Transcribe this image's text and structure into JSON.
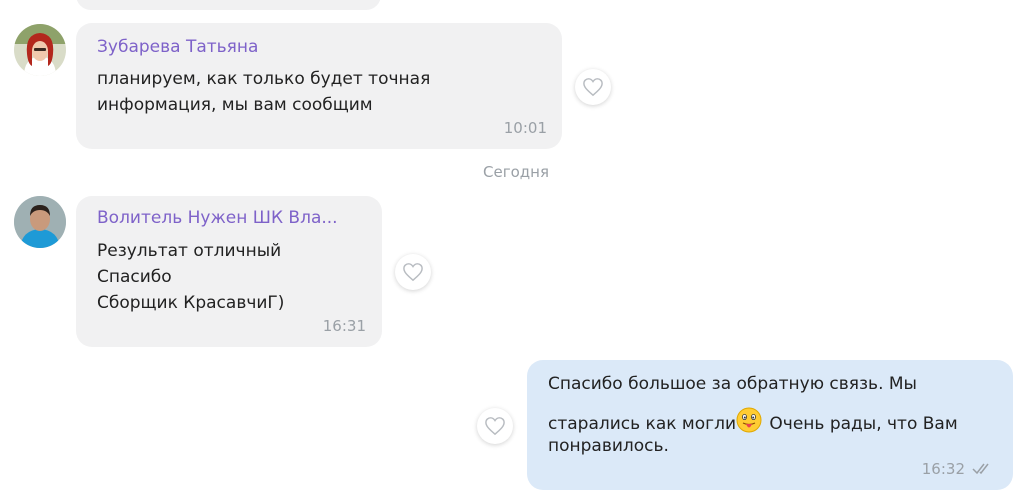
{
  "date_separator": "Сегодня",
  "messages": [
    {
      "sender": "Зубарева Татьяна",
      "lines": [
        "планируем, как только будет точная",
        "информация, мы вам сообщим"
      ],
      "time": "10:01",
      "avatar_icon": "avatar-woman-red-hair"
    },
    {
      "sender": "Волитель Нужен ШК Вла...",
      "lines": [
        "Результат отличный",
        "Спасибо",
        "Сборщик КрасавчиГ)"
      ],
      "time": "16:31",
      "avatar_icon": "avatar-man"
    },
    {
      "line1": "Спасибо большое за обратную связь.  Мы",
      "line2_before": "старались как могли",
      "line2_after": " Очень рады, что Вам",
      "line3": "понравилось.",
      "emoji": "tongue-out-emoji",
      "time": "16:32",
      "status_icon": "double-check-icon"
    }
  ],
  "colors": {
    "sender_name": "#7e62c9",
    "incoming_bubble": "#f1f1f2",
    "outgoing_bubble": "#dbe9f8",
    "timestamp": "#9aa0a6"
  }
}
